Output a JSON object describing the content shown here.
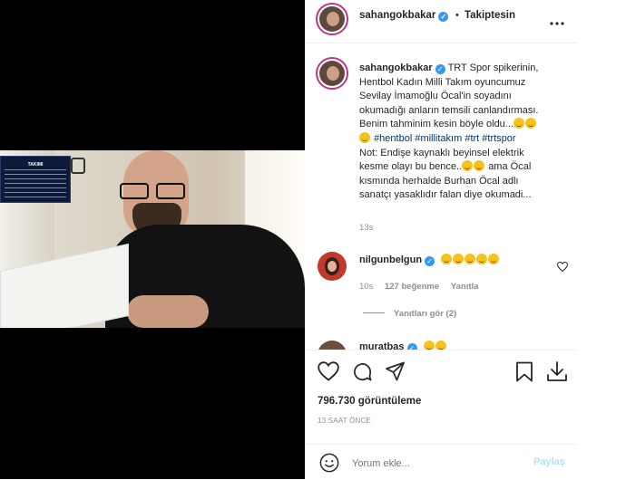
{
  "post": {
    "username": "sahangokbakar",
    "follow_status": "Takiptesin",
    "separator": "•",
    "more_icon": "more-dots-icon"
  },
  "caption": {
    "username": "sahangokbakar",
    "line1": "TRT Spor spikerinin,",
    "line2": "Hentbol Kadın Milli Takım oyuncumuz",
    "line3": "Sevilay İmamoğlu Öcal'in soyadını",
    "line4": "okumadığı anların temsili canlandırması.",
    "line5": "Benim tahminim kesin böyle oldu...",
    "hashtags": "#hentbol #millitakım #trt #trtspor",
    "line7": "Not: Endişe kaynaklı beyinsel elektrik",
    "line8": "kesme olayı bu bence..",
    "line8b": "ama Öcal",
    "line9": "kısmında herhalde Burhan Öcal adlı",
    "line10": "sanatçı yasaklıdır falan diye okumadi...",
    "time": "13s"
  },
  "comment": {
    "username": "nilgunbelgun",
    "time": "10s",
    "likes": "127 beğenme",
    "reply": "Yanıtla",
    "view_replies": "Yanıtları gör (2)"
  },
  "next_comment": {
    "username": "muratbas"
  },
  "stats": {
    "views": "796.730 görüntüleme",
    "posted": "13 SAAT ÖNCE"
  },
  "composer": {
    "placeholder": "Yorum ekle...",
    "share": "Paylaş"
  },
  "video": {
    "overlay_title": "TAKIMI"
  }
}
